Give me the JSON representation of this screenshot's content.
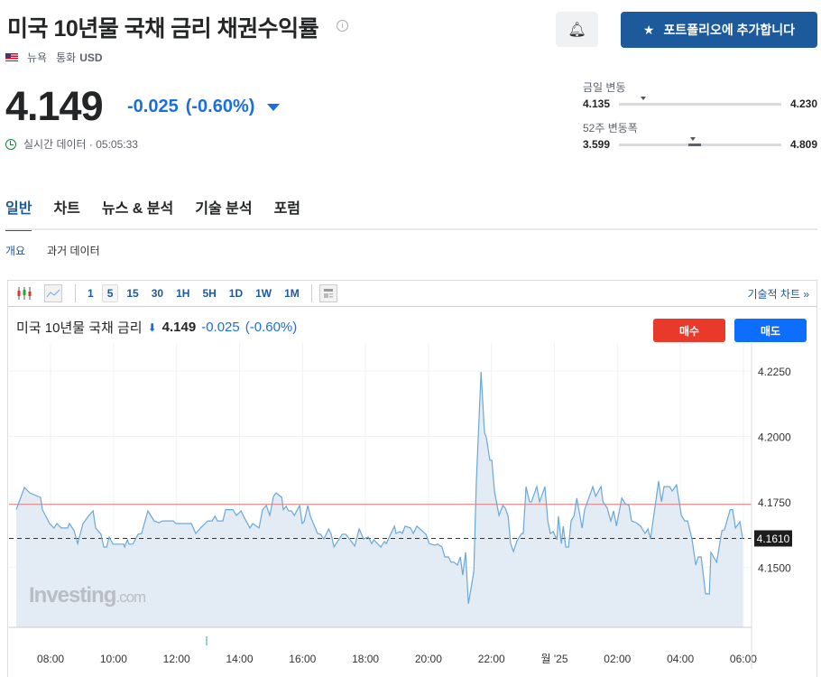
{
  "header": {
    "title": "미국 10년물 국채 금리 채권수익률",
    "info_icon": "i",
    "portfolio_button": "포트폴리오에 추가합니다",
    "exchange": "뉴욕",
    "currency_label": "통화",
    "currency": "USD"
  },
  "quote": {
    "price": "4.149",
    "change": "-0.025",
    "change_pct": "(-0.60%)",
    "realtime_label": "실시간 데이터 · 05:05:33",
    "change_color": "#1a6fe0"
  },
  "ranges": [
    {
      "label": "금일 변동",
      "low": "4.135",
      "high": "4.230",
      "current": 4.149
    },
    {
      "label": "52주 변동폭",
      "low": "3.599",
      "high": "4.809",
      "current": 4.149
    }
  ],
  "tabs": [
    {
      "label": "일반",
      "active": true
    },
    {
      "label": "차트"
    },
    {
      "label": "뉴스 & 분석"
    },
    {
      "label": "기술 분석"
    },
    {
      "label": "포럼"
    }
  ],
  "subtabs": [
    {
      "label": "개요",
      "active": true
    },
    {
      "label": "과거 데이터"
    }
  ],
  "toolbar": {
    "intervals": [
      "1",
      "5",
      "15",
      "30",
      "1H",
      "5H",
      "1D",
      "1W",
      "1M"
    ],
    "active_interval": "5",
    "tech_chart": "기술적 차트 »"
  },
  "chart_header": {
    "name": "미국 10년물 국채 금리",
    "price": "4.149",
    "change": "-0.025",
    "pct": "(-0.60%)",
    "buy": "매수",
    "sell": "매도"
  },
  "watermark": {
    "brand": "Investing",
    "suffix": ".com"
  },
  "chart_data": {
    "type": "area",
    "x_unit": "hours since 00:00 day 1",
    "xlim": [
      6.68,
      30.26
    ],
    "ylim": [
      4.127,
      4.2357
    ],
    "yticks": [
      4.15,
      4.175,
      4.2,
      4.225
    ],
    "ytick_labels": [
      "4.1500",
      "4.1750",
      "4.2000",
      "4.2250"
    ],
    "xticks": [
      8,
      10,
      12,
      14,
      16,
      18,
      20,
      22,
      24,
      26,
      28,
      30
    ],
    "xtick_labels": [
      "08:00",
      "10:00",
      "12:00",
      "14:00",
      "16:00",
      "18:00",
      "20:00",
      "22:00",
      "월 '25",
      "02:00",
      "04:00",
      "06:00"
    ],
    "prev_close": 4.174,
    "last_value": 4.161,
    "last_label": "4.1610",
    "points": [
      [
        6.91,
        4.172
      ],
      [
        7.17,
        4.1805
      ],
      [
        7.34,
        4.1784
      ],
      [
        7.68,
        4.1767
      ],
      [
        7.74,
        4.172
      ],
      [
        7.97,
        4.1667
      ],
      [
        8.11,
        4.165
      ],
      [
        8.2,
        4.1667
      ],
      [
        8.34,
        4.165
      ],
      [
        8.54,
        4.165
      ],
      [
        8.6,
        4.1667
      ],
      [
        8.75,
        4.1639
      ],
      [
        8.86,
        4.159
      ],
      [
        9.03,
        4.1667
      ],
      [
        9.2,
        4.1695
      ],
      [
        9.35,
        4.1715
      ],
      [
        9.43,
        4.165
      ],
      [
        9.6,
        4.1626
      ],
      [
        9.69,
        4.1577
      ],
      [
        9.78,
        4.1577
      ],
      [
        9.86,
        4.1615
      ],
      [
        9.98,
        4.1588
      ],
      [
        10.32,
        4.1588
      ],
      [
        10.35,
        4.1577
      ],
      [
        10.44,
        4.1605
      ],
      [
        10.49,
        4.1588
      ],
      [
        10.61,
        4.1588
      ],
      [
        10.78,
        4.1626
      ],
      [
        10.89,
        4.1629
      ],
      [
        11.09,
        4.1715
      ],
      [
        11.29,
        4.1677
      ],
      [
        11.44,
        4.167
      ],
      [
        11.55,
        4.1677
      ],
      [
        11.9,
        4.1677
      ],
      [
        11.98,
        4.1667
      ],
      [
        12.47,
        4.1667
      ],
      [
        12.61,
        4.1629
      ],
      [
        12.76,
        4.165
      ],
      [
        12.99,
        4.1677
      ],
      [
        13.13,
        4.1677
      ],
      [
        13.22,
        4.1695
      ],
      [
        13.3,
        4.1677
      ],
      [
        13.47,
        4.1677
      ],
      [
        13.56,
        4.172
      ],
      [
        13.79,
        4.172
      ],
      [
        13.9,
        4.1698
      ],
      [
        14.05,
        4.1715
      ],
      [
        14.13,
        4.1695
      ],
      [
        14.33,
        4.165
      ],
      [
        14.42,
        4.1667
      ],
      [
        14.62,
        4.165
      ],
      [
        14.73,
        4.172
      ],
      [
        14.85,
        4.1736
      ],
      [
        14.96,
        4.1698
      ],
      [
        15.08,
        4.1771
      ],
      [
        15.16,
        4.1784
      ],
      [
        15.34,
        4.1767
      ],
      [
        15.39,
        4.172
      ],
      [
        15.48,
        4.1733
      ],
      [
        15.56,
        4.1715
      ],
      [
        15.65,
        4.1715
      ],
      [
        15.74,
        4.1698
      ],
      [
        15.91,
        4.1736
      ],
      [
        15.99,
        4.1667
      ],
      [
        16.05,
        4.1674
      ],
      [
        16.17,
        4.1736
      ],
      [
        16.25,
        4.1695
      ],
      [
        16.48,
        4.1629
      ],
      [
        16.57,
        4.1626
      ],
      [
        16.68,
        4.1608
      ],
      [
        16.83,
        4.1646
      ],
      [
        16.91,
        4.1626
      ],
      [
        17.0,
        4.1577
      ],
      [
        17.26,
        4.1626
      ],
      [
        17.37,
        4.1626
      ],
      [
        17.51,
        4.1605
      ],
      [
        17.66,
        4.1581
      ],
      [
        17.8,
        4.1646
      ],
      [
        17.94,
        4.1608
      ],
      [
        18.09,
        4.1615
      ],
      [
        18.2,
        4.159
      ],
      [
        18.26,
        4.1605
      ],
      [
        18.49,
        4.1577
      ],
      [
        18.6,
        4.1598
      ],
      [
        18.66,
        4.159
      ],
      [
        18.92,
        4.1657
      ],
      [
        18.97,
        4.1629
      ],
      [
        19.09,
        4.1636
      ],
      [
        19.17,
        4.1629
      ],
      [
        19.26,
        4.1657
      ],
      [
        19.43,
        4.165
      ],
      [
        19.52,
        4.1629
      ],
      [
        19.63,
        4.1657
      ],
      [
        19.92,
        4.1626
      ],
      [
        20.03,
        4.159
      ],
      [
        20.21,
        4.1584
      ],
      [
        20.29,
        4.1588
      ],
      [
        20.43,
        4.1577
      ],
      [
        20.52,
        4.1539
      ],
      [
        20.64,
        4.1539
      ],
      [
        20.72,
        4.1519
      ],
      [
        20.81,
        4.1519
      ],
      [
        20.92,
        4.1508
      ],
      [
        21.01,
        4.1539
      ],
      [
        21.09,
        4.147
      ],
      [
        21.18,
        4.1557
      ],
      [
        21.27,
        4.136
      ],
      [
        21.44,
        4.1484
      ],
      [
        21.52,
        4.1829
      ],
      [
        21.67,
        4.2247
      ],
      [
        21.78,
        4.2015
      ],
      [
        21.84,
        4.1995
      ],
      [
        21.95,
        4.1909
      ],
      [
        22.01,
        4.1909
      ],
      [
        22.1,
        4.1788
      ],
      [
        22.24,
        4.1698
      ],
      [
        22.36,
        4.1736
      ],
      [
        22.44,
        4.1726
      ],
      [
        22.53,
        4.1695
      ],
      [
        22.61,
        4.159
      ],
      [
        22.7,
        4.156
      ],
      [
        22.81,
        4.1601
      ],
      [
        22.96,
        4.1629
      ],
      [
        23.01,
        4.1629
      ],
      [
        23.1,
        4.1808
      ],
      [
        23.21,
        4.175
      ],
      [
        23.27,
        4.175
      ],
      [
        23.44,
        4.1808
      ],
      [
        23.53,
        4.175
      ],
      [
        23.7,
        4.1808
      ],
      [
        23.79,
        4.1677
      ],
      [
        23.87,
        4.1629
      ],
      [
        23.96,
        4.1636
      ],
      [
        24.08,
        4.1605
      ],
      [
        24.13,
        4.1695
      ],
      [
        24.22,
        4.159
      ],
      [
        24.28,
        4.1657
      ],
      [
        24.36,
        4.1577
      ],
      [
        24.45,
        4.1577
      ],
      [
        24.53,
        4.1677
      ],
      [
        24.62,
        4.1695
      ],
      [
        24.71,
        4.1764
      ],
      [
        24.88,
        4.165
      ],
      [
        24.96,
        4.172
      ],
      [
        25.22,
        4.1808
      ],
      [
        25.31,
        4.1771
      ],
      [
        25.48,
        4.1808
      ],
      [
        25.54,
        4.175
      ],
      [
        25.68,
        4.1726
      ],
      [
        25.79,
        4.1677
      ],
      [
        25.88,
        4.1715
      ],
      [
        25.97,
        4.1658
      ],
      [
        26.14,
        4.1764
      ],
      [
        26.25,
        4.1743
      ],
      [
        26.37,
        4.1736
      ],
      [
        26.45,
        4.1677
      ],
      [
        26.6,
        4.167
      ],
      [
        26.74,
        4.1657
      ],
      [
        26.88,
        4.1629
      ],
      [
        26.97,
        4.1646
      ],
      [
        27.05,
        4.1608
      ],
      [
        27.31,
        4.1829
      ],
      [
        27.4,
        4.175
      ],
      [
        27.48,
        4.1808
      ],
      [
        27.66,
        4.1808
      ],
      [
        27.74,
        4.1791
      ],
      [
        27.88,
        4.1815
      ],
      [
        28.03,
        4.1698
      ],
      [
        28.14,
        4.1677
      ],
      [
        28.23,
        4.1677
      ],
      [
        28.37,
        4.1608
      ],
      [
        28.49,
        4.1508
      ],
      [
        28.57,
        4.1539
      ],
      [
        28.66,
        4.1539
      ],
      [
        28.8,
        4.1398
      ],
      [
        28.92,
        4.1398
      ],
      [
        28.97,
        4.1557
      ],
      [
        29.15,
        4.1519
      ],
      [
        29.32,
        4.164
      ],
      [
        29.4,
        4.1643
      ],
      [
        29.58,
        4.172
      ],
      [
        29.66,
        4.172
      ],
      [
        29.75,
        4.165
      ],
      [
        29.89,
        4.1674
      ],
      [
        29.98,
        4.1608
      ]
    ],
    "colors": {
      "line": "#6aa8d8",
      "fill": "#e3ecf5",
      "prev_close": "#e57373"
    }
  }
}
